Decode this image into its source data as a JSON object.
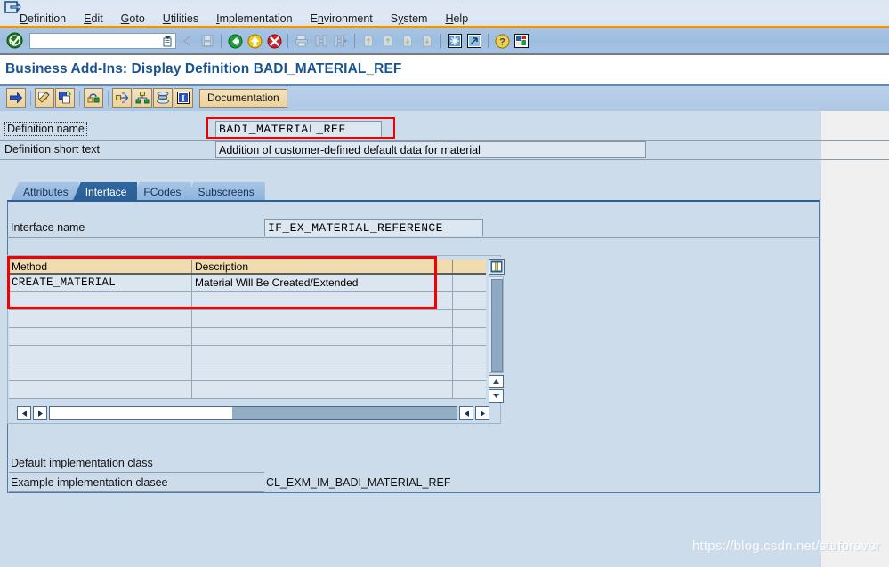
{
  "window": {
    "icon": "sap-window-icon"
  },
  "menu": {
    "items": [
      {
        "label": "Definition",
        "accel": "D"
      },
      {
        "label": "Edit",
        "accel": "E"
      },
      {
        "label": "Goto",
        "accel": "G"
      },
      {
        "label": "Utilities",
        "accel": "U"
      },
      {
        "label": "Implementation",
        "accel": "I"
      },
      {
        "label": "Environment",
        "accel": "n"
      },
      {
        "label": "System",
        "accel": "y"
      },
      {
        "label": "Help",
        "accel": "H"
      }
    ]
  },
  "toolbar": {
    "ok_icon": "green-check-icon",
    "command_field": {
      "value": "",
      "placeholder": "",
      "dropdown_icon": "command-history-icon"
    },
    "buttons": [
      {
        "name": "back-icon",
        "glyph": "◀"
      },
      {
        "name": "save-icon",
        "glyph": "save"
      },
      {
        "name": "back-green-icon",
        "glyph": "back"
      },
      {
        "name": "exit-yellow-icon",
        "glyph": "exit"
      },
      {
        "name": "cancel-red-icon",
        "glyph": "cancel"
      },
      {
        "name": "print-icon",
        "glyph": "print"
      },
      {
        "name": "find-icon",
        "glyph": "find"
      },
      {
        "name": "find-next-icon",
        "glyph": "findnext"
      },
      {
        "name": "first-page-icon",
        "glyph": "first"
      },
      {
        "name": "previous-page-icon",
        "glyph": "prev"
      },
      {
        "name": "next-page-icon",
        "glyph": "next"
      },
      {
        "name": "last-page-icon",
        "glyph": "last"
      },
      {
        "name": "create-session-icon",
        "glyph": "session"
      },
      {
        "name": "create-shortcut-icon",
        "glyph": "shortcut"
      },
      {
        "name": "help-icon",
        "glyph": "help"
      },
      {
        "name": "customize-layout-icon",
        "glyph": "layout"
      }
    ]
  },
  "title": "Business Add-Ins: Display Definition BADI_MATERIAL_REF",
  "apptoolbar": {
    "buttons": [
      {
        "name": "display-change-arrow-icon"
      },
      {
        "name": "edit-pencil-icon"
      },
      {
        "name": "copy-icon"
      },
      {
        "name": "lock-icon"
      },
      {
        "name": "where-used-icon"
      },
      {
        "name": "hierarchy-icon"
      },
      {
        "name": "stack-icon"
      },
      {
        "name": "info-icon"
      }
    ],
    "documentation_label": "Documentation"
  },
  "form": {
    "definition_name_label": "Definition name",
    "definition_name_value": "BADI_MATERIAL_REF",
    "definition_short_text_label": "Definition short text",
    "definition_short_text_value": "Addition of customer-defined default data for material"
  },
  "tabs": [
    {
      "label": "Attributes",
      "selected": false
    },
    {
      "label": "Interface",
      "selected": true
    },
    {
      "label": "FCodes",
      "selected": false
    },
    {
      "label": "Subscreens",
      "selected": false
    }
  ],
  "interface": {
    "name_label": "Interface name",
    "name_value": "IF_EX_MATERIAL_REFERENCE"
  },
  "grid": {
    "columns": [
      "Method",
      "Description",
      ""
    ],
    "config_icon": "table-settings-icon",
    "rows": [
      [
        "CREATE_MATERIAL",
        "Material Will Be Created/Extended",
        ""
      ],
      [
        "",
        "",
        ""
      ],
      [
        "",
        "",
        ""
      ],
      [
        "",
        "",
        ""
      ],
      [
        "",
        "",
        ""
      ],
      [
        "",
        "",
        ""
      ],
      [
        "",
        "",
        ""
      ]
    ],
    "vscroll": {
      "up_icon": "scroll-up-icon",
      "down_icon": "scroll-down-icon"
    },
    "hscroll": {
      "left_icon": "scroll-left-icon",
      "right_icon": "scroll-right-icon"
    }
  },
  "footer": {
    "default_impl_label": "Default implementation class",
    "default_impl_value": "",
    "example_impl_label": "Example implementation clasee",
    "example_impl_value": "CL_EXM_IM_BADI_MATERIAL_REF"
  },
  "watermark": "https://blog.csdn.net/stuforever",
  "colors": {
    "accent_orange": "#f29400",
    "title_blue": "#1a5490",
    "tab_selected": "#2b5f95",
    "panel_bg": "#ccdcea",
    "field_bg": "#dce7f2",
    "grid_header": "#f0dcae",
    "annotation_red": "#f40000"
  }
}
